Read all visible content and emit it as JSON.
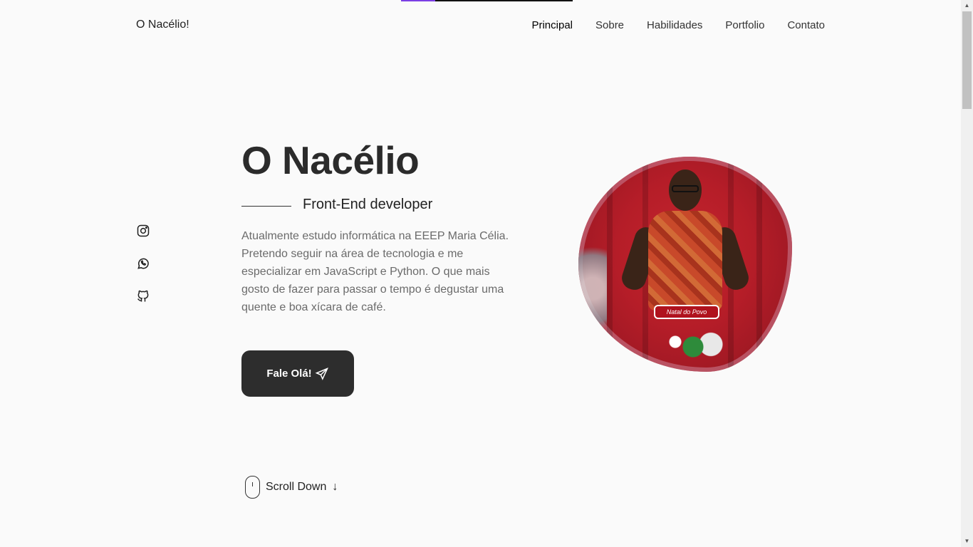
{
  "header": {
    "logo": "O Nacélio!",
    "nav": [
      {
        "label": "Principal",
        "active": true
      },
      {
        "label": "Sobre",
        "active": false
      },
      {
        "label": "Habilidades",
        "active": false
      },
      {
        "label": "Portfolio",
        "active": false
      },
      {
        "label": "Contato",
        "active": false
      }
    ]
  },
  "socials": [
    {
      "icon": "instagram-icon"
    },
    {
      "icon": "whatsapp-icon"
    },
    {
      "icon": "github-icon"
    }
  ],
  "hero": {
    "title": "O Nacélio",
    "subtitle": "Front-End developer",
    "description": "Atualmente estudo informática na EEEP Maria Célia. Pretendo seguir na área de tecnologia e me especializar em JavaScript e Python. O que mais gosto de fazer para passar o tempo é degustar uma quente e boa xícara de café.",
    "cta_label": "Fale Olá!",
    "photo_sign_text": "Natal do Povo"
  },
  "scroll": {
    "label": "Scroll Down"
  },
  "colors": {
    "background": "#fafafa",
    "button": "#2d2d2d",
    "accent": "#7b3fe4"
  }
}
